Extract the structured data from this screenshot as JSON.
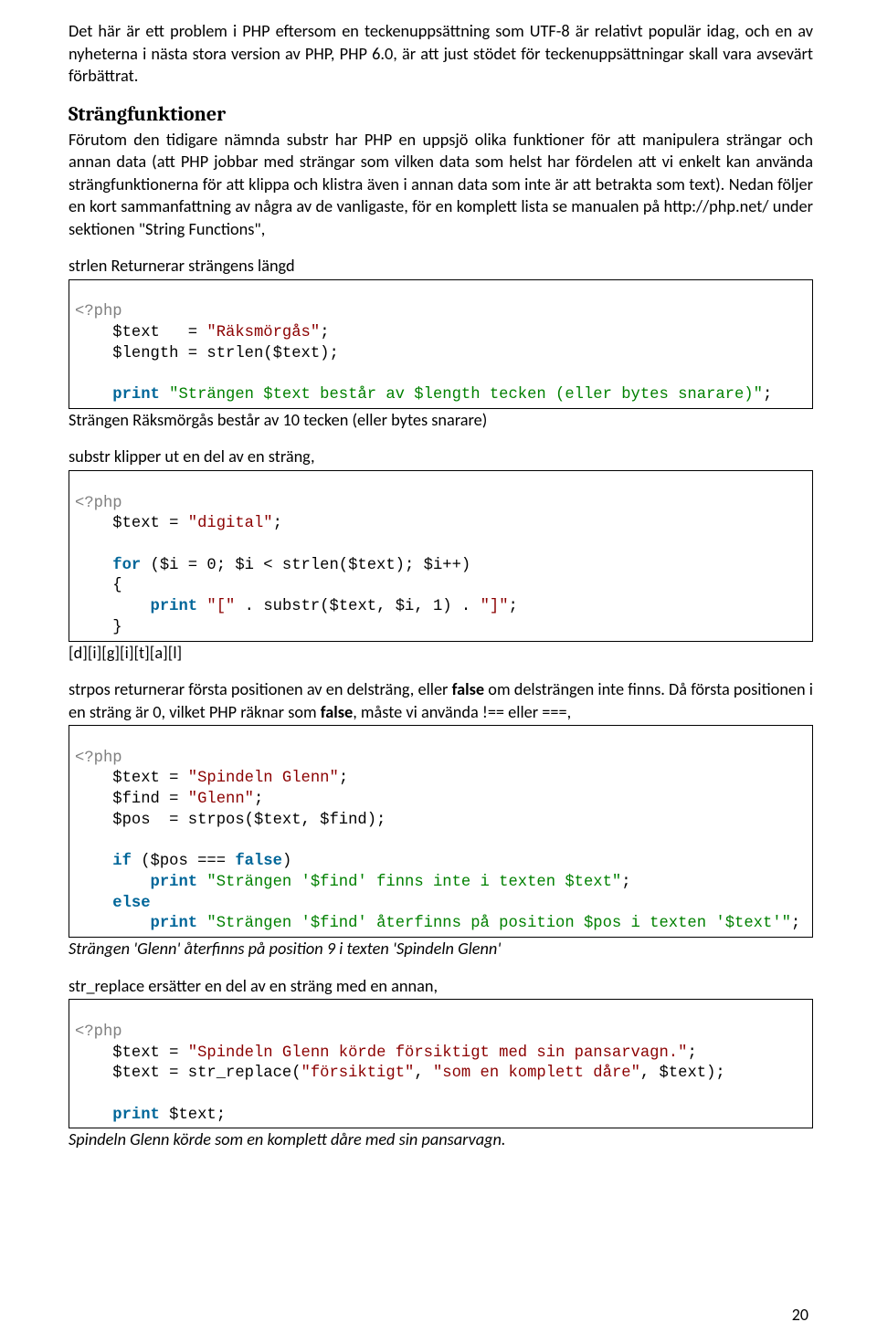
{
  "paragraphs": {
    "intro": "Det här är ett problem i PHP eftersom en teckenuppsättning som UTF-8 är relativt populär idag, och en av nyheterna i nästa stora version av PHP, PHP 6.0, är att just stödet för teckenuppsättningar skall vara avsevärt förbättrat.",
    "heading": "Strängfunktioner",
    "strang_body": "Förutom den tidigare nämnda substr har PHP en uppsjö olika funktioner för att manipulera strängar och annan data (att PHP jobbar med strängar som vilken data som helst har fördelen att vi enkelt kan använda strängfunktionerna för att klippa och klistra även i annan data som inte är att betrakta som text). Nedan följer en kort sammanfattning av några av de vanligaste, för en komplett lista se manualen på http://php.net/ under sektionen \"String Functions\","
  },
  "strlen": {
    "intro": "strlen Returnerar strängens längd",
    "php_open": "<?php",
    "l1a": "    $text   = ",
    "l1b": "\"Räksmörgås\"",
    "l1c": ";",
    "l2a": "    $length = strlen($text);",
    "l3_print": "    print",
    "l3_str": " \"Strängen $text består av $length tecken (eller bytes snarare)\"",
    "l3_semi": ";",
    "output": "Strängen Räksmörgås består av 10 tecken (eller bytes snarare)"
  },
  "substr": {
    "intro": "substr klipper ut en del av en sträng,",
    "php_open": "<?php",
    "l1a": "    $text = ",
    "l1b": "\"digital\"",
    "l1c": ";",
    "for_kw": "    for",
    "for_rest": " ($i = 0; $i < strlen($text); $i++)",
    "brace_o": "    {",
    "pl_print": "        print",
    "pl_s1": " \"[\"",
    "pl_dot1": " . ",
    "pl_sub": "substr($text, $i, 1)",
    "pl_dot2": " . ",
    "pl_s2": "\"]\"",
    "pl_semi": ";",
    "brace_c": "    }",
    "output": "[d][i][g][i][t][a][l]"
  },
  "strpos": {
    "intro_a": "strpos returnerar första positionen av en delsträng, eller ",
    "intro_b": "false",
    "intro_c": " om delsträngen inte finns. Då första positionen i en sträng är 0, vilket PHP räknar som ",
    "intro_d": "false",
    "intro_e": ", måste vi använda !== eller ===,",
    "php_open": "<?php",
    "l1a": "    $text = ",
    "l1b": "\"Spindeln Glenn\"",
    "l1c": ";",
    "l2a": "    $find = ",
    "l2b": "\"Glenn\"",
    "l2c": ";",
    "l3": "    $pos  = strpos($text, $find);",
    "if_kw": "    if",
    "if_rest": " ($pos === ",
    "if_false": "false",
    "if_paren": ")",
    "if_print": "        print",
    "if_str": " \"Strängen '$find' finns inte i texten $text\"",
    "if_semi": ";",
    "else_kw": "    else",
    "else_print": "        print",
    "else_str": " \"Strängen '$find' återfinns på position $pos i texten '$text'\"",
    "else_semi": ";",
    "output": "Strängen 'Glenn' återfinns på position 9 i texten 'Spindeln Glenn'"
  },
  "strreplace": {
    "intro": "str_replace ersätter en del av en sträng med en annan,",
    "php_open": "<?php",
    "l1a": "    $text = ",
    "l1b": "\"Spindeln Glenn körde försiktigt med sin pansarvagn.\"",
    "l1c": ";",
    "l2a": "    $text = str_replace(",
    "l2b": "\"försiktigt\"",
    "l2c": ", ",
    "l2d": "\"som en komplett dåre\"",
    "l2e": ", $text);",
    "l3_print": "    print",
    "l3_rest": " $text;",
    "output": "Spindeln Glenn körde som en komplett dåre med sin pansarvagn."
  },
  "page_number": "20"
}
